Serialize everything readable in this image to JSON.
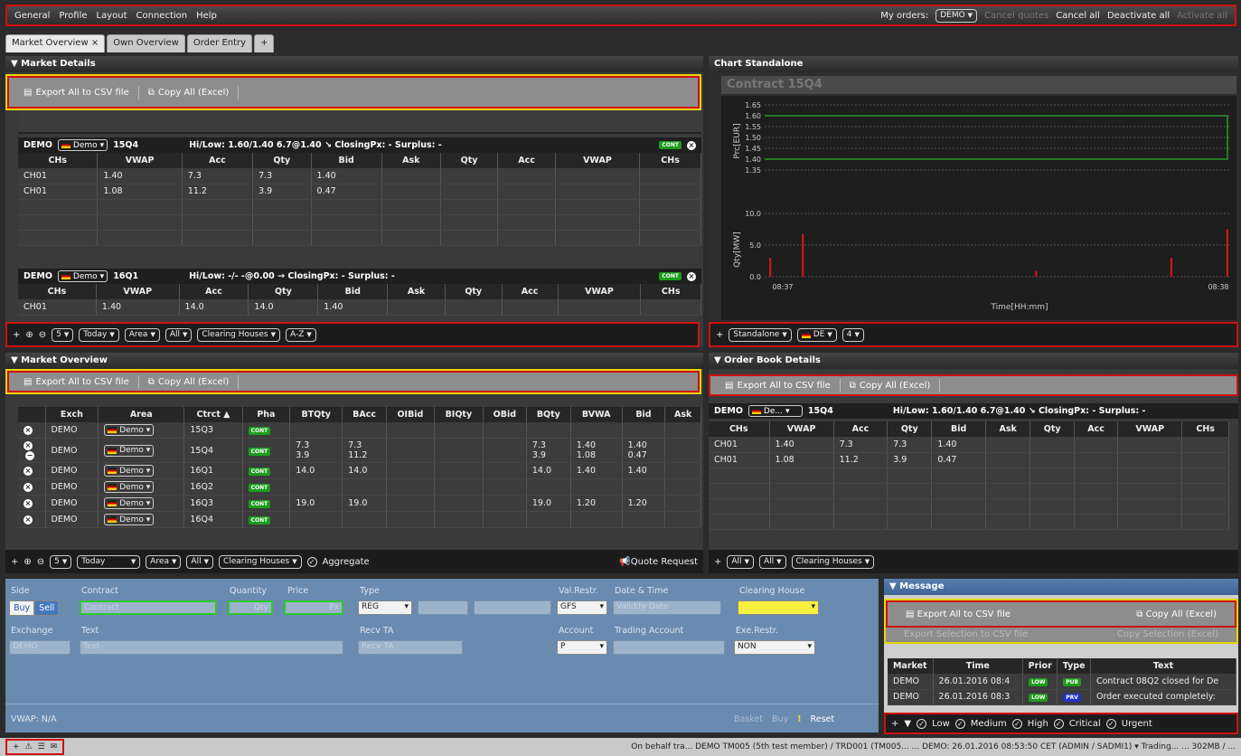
{
  "menu": {
    "items": [
      "General",
      "Profile",
      "Layout",
      "Connection",
      "Help"
    ],
    "my_orders_label": "My orders:",
    "my_orders_value": "DEMO",
    "cancel_quotes": "Cancel quotes",
    "cancel_all": "Cancel all",
    "deactivate_all": "Deactivate all",
    "activate_all": "Activate all"
  },
  "tabs": [
    {
      "label": "Market Overview ×"
    },
    {
      "label": "Own Overview"
    },
    {
      "label": "Order Entry"
    },
    {
      "label": "+"
    }
  ],
  "market_details": {
    "title": "▼ Market Details",
    "export_csv": "Export All to CSV file",
    "copy_all": "Copy All (Excel)",
    "contract1": {
      "exch": "DEMO",
      "area": "Demo",
      "ctrct": "15Q4",
      "info": "Hi/Low:  1.60/1.40   6.7@1.40 ↘ ClosingPx: - Surplus: -",
      "state": "CONT"
    },
    "contract2": {
      "exch": "DEMO",
      "area": "Demo",
      "ctrct": "16Q1",
      "info": "Hi/Low:  -/-   -@0.00 → ClosingPx: - Surplus: -",
      "state": "CONT"
    },
    "columns": [
      "CHs",
      "VWAP",
      "Acc",
      "Qty",
      "Bid",
      "Ask",
      "Qty",
      "Acc",
      "VWAP",
      "CHs"
    ],
    "rows1": [
      [
        "CH01",
        "1.40",
        "7.3",
        "7.3",
        "1.40"
      ],
      [
        "CH01",
        "1.08",
        "11.2",
        "3.9",
        "0.47"
      ]
    ],
    "rows2": [
      [
        "CH01",
        "1.40",
        "14.0",
        "14.0",
        "1.40"
      ]
    ],
    "bottom": {
      "depth": "5",
      "day": "Today",
      "area": "Area",
      "all": "All",
      "ch": "Clearing Houses",
      "sort": "A-Z"
    }
  },
  "chart": {
    "title": "Chart Standalone",
    "contract": "Contract 15Q4",
    "ylabel_top": "Prc[EUR]",
    "ylabel_bottom": "Qty[MW]",
    "xlabel": "Time[HH:mm]",
    "yticks_top": [
      "1.65",
      "1.60",
      "1.55",
      "1.50",
      "1.45",
      "1.40",
      "1.35"
    ],
    "yticks_bottom": [
      "10.0",
      "5.0",
      "0.0"
    ],
    "xticks": [
      "08:37",
      "08:38"
    ],
    "chart_data": {
      "type": "bar",
      "title": "Contract 15Q4",
      "xlabel": "Time[HH:mm]",
      "ylabel": "Qty[MW]",
      "ylim": [
        0,
        10
      ],
      "values": [
        3.0,
        6.8,
        0.9,
        3.0,
        7.5
      ],
      "price_levels": [
        1.6,
        1.4
      ]
    },
    "bottom": {
      "mode": "Standalone",
      "area": "DE",
      "depth": "4"
    }
  },
  "overview": {
    "title": "▼ Market Overview",
    "export_csv": "Export All to CSV file",
    "copy_all": "Copy All (Excel)",
    "columns": [
      "Exch",
      "Area",
      "Ctrct ▲",
      "Pha",
      "BTQty",
      "BAcc",
      "OIBid",
      "BIQty",
      "OBid",
      "BQty",
      "BVWA",
      "Bid",
      "Ask"
    ],
    "rows": [
      [
        "DEMO",
        "Demo",
        "15Q3",
        "CONT",
        "",
        "",
        "",
        "",
        "",
        "",
        "",
        "",
        ""
      ],
      [
        "DEMO",
        "Demo",
        "15Q4",
        "CONT",
        "7.3\n3.9",
        "7.3\n11.2",
        "",
        "",
        "",
        "7.3\n3.9",
        "1.40\n1.08",
        "1.40\n0.47",
        ""
      ],
      [
        "DEMO",
        "Demo",
        "16Q1",
        "CONT",
        "14.0",
        "14.0",
        "",
        "",
        "",
        "14.0",
        "1.40",
        "1.40",
        ""
      ],
      [
        "DEMO",
        "Demo",
        "16Q2",
        "CONT",
        "",
        "",
        "",
        "",
        "",
        "",
        "",
        "",
        ""
      ],
      [
        "DEMO",
        "Demo",
        "16Q3",
        "CONT",
        "19.0",
        "19.0",
        "",
        "",
        "",
        "19.0",
        "1.20",
        "1.20",
        ""
      ],
      [
        "DEMO",
        "Demo",
        "16Q4",
        "CONT",
        "",
        "",
        "",
        "",
        "",
        "",
        "",
        "",
        ""
      ]
    ],
    "bottom": {
      "depth": "5",
      "day": "Today",
      "area": "Area",
      "all": "All",
      "ch": "Clearing Houses",
      "aggregate": "Aggregate",
      "quote": "Quote Request"
    }
  },
  "orderbook": {
    "title": "▼ Order Book Details",
    "export_csv": "Export All to CSV file",
    "copy_all": "Copy All (Excel)",
    "exch": "DEMO",
    "area": "De...",
    "ctrct": "15Q4",
    "info": "Hi/Low:  1.60/1.40   6.7@1.40 ↘ ClosingPx: - Surplus: -",
    "columns": [
      "CHs",
      "VWAP",
      "Acc",
      "Qty",
      "Bid",
      "Ask",
      "Qty",
      "Acc",
      "VWAP",
      "CHs"
    ],
    "rows": [
      [
        "CH01",
        "1.40",
        "7.3",
        "7.3",
        "1.40"
      ],
      [
        "CH01",
        "1.08",
        "11.2",
        "3.9",
        "0.47"
      ]
    ],
    "bottom": {
      "all1": "All",
      "all2": "All",
      "ch": "Clearing Houses"
    }
  },
  "order_entry": {
    "side": "Side",
    "buy": "Buy",
    "sell": "Sell",
    "contract": "Contract",
    "contract_ph": "Contract",
    "quantity": "Quantity",
    "qty_ph": "Qty",
    "price": "Price",
    "price_ph": "Px",
    "type": "Type",
    "type_val": "REG",
    "valrestr": "Val.Restr.",
    "valrestr_val": "GFS",
    "datetime": "Date & Time",
    "datetime_ph": "Validity Date",
    "clearing": "Clearing House",
    "exchange": "Exchange",
    "exchange_val": "DEMO",
    "text": "Text",
    "text_ph": "Text",
    "recvta": "Recv TA",
    "recvta_ph": "Recv TA",
    "account": "Account",
    "account_val": "P",
    "trading_account": "Trading Account",
    "exerestr": "Exe.Restr.",
    "exerestr_val": "NON",
    "vwap": "VWAP:  N/A",
    "basket": "Basket",
    "buy_btn": "Buy",
    "reset": "Reset"
  },
  "message": {
    "title": "▼ Message",
    "export_csv": "Export All to CSV file",
    "copy_all": "Copy All (Excel)",
    "export_sel": "Export Selection to CSV file",
    "copy_sel": "Copy Selection (Excel)",
    "columns": [
      "Market",
      "Time",
      "Prior",
      "Type",
      "Text"
    ],
    "rows": [
      [
        "DEMO",
        "26.01.2016 08:4",
        "LOW",
        "PUB",
        "Contract 08Q2 closed for De"
      ],
      [
        "DEMO",
        "26.01.2016 08:3",
        "LOW",
        "PRV",
        "Order executed completely:"
      ]
    ],
    "filters": [
      "Low",
      "Medium",
      "High",
      "Critical",
      "Urgent"
    ]
  },
  "status": {
    "text": "On behalf tra...  DEMO TM005 (5th test member) / TRD001 (TM005...   ...   DEMO: 26.01.2016 08:53:50 CET (ADMIN / SADMI1) ▾   Trading...  ...  302MB / ..."
  }
}
